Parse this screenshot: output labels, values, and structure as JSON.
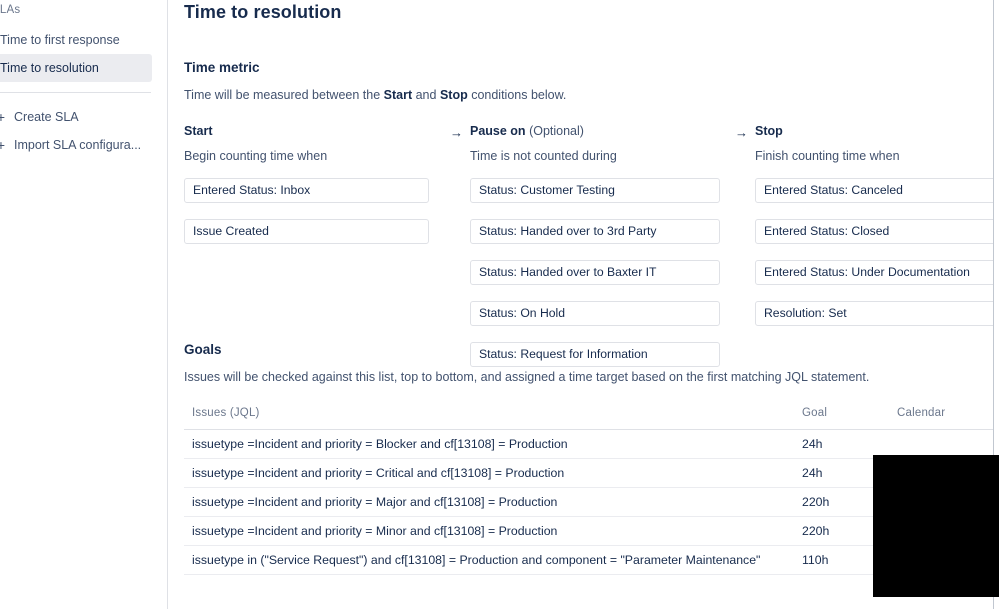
{
  "sidebar": {
    "heading": "SLAs",
    "items": [
      {
        "label": "Time to first response",
        "selected": false
      },
      {
        "label": "Time to resolution",
        "selected": true
      }
    ],
    "actions": [
      {
        "icon": "plus-icon",
        "label": "Create SLA"
      },
      {
        "icon": "plus-icon",
        "label": "Import SLA configura..."
      }
    ]
  },
  "main": {
    "page_title": "Time to resolution",
    "time_metric": {
      "title": "Time metric",
      "desc_prefix": "Time will be measured between the ",
      "desc_start": "Start",
      "desc_mid": " and ",
      "desc_stop": "Stop",
      "desc_suffix": " conditions below."
    },
    "arrow_glyph": "→",
    "columns": {
      "start": {
        "title": "Start",
        "optional": "",
        "subtitle": "Begin counting time when",
        "conditions": [
          "Entered Status: Inbox",
          "Issue Created"
        ]
      },
      "pause": {
        "title": "Pause on",
        "optional": "(Optional)",
        "subtitle": "Time is not counted during",
        "conditions": [
          "Status: Customer Testing",
          "Status: Handed over to 3rd Party",
          "Status: Handed over to Baxter IT",
          "Status: On Hold",
          "Status: Request for Information"
        ]
      },
      "stop": {
        "title": "Stop",
        "optional": "",
        "subtitle": "Finish counting time when",
        "conditions": [
          "Entered Status: Canceled",
          "Entered Status: Closed",
          "Entered Status: Under Documentation",
          "Resolution: Set"
        ]
      }
    },
    "goals": {
      "title": "Goals",
      "desc": "Issues will be checked against this list, top to bottom, and assigned a time target based on the first matching JQL statement.",
      "columns": [
        "Issues (JQL)",
        "Goal",
        "Calendar"
      ],
      "rows": [
        {
          "jql": "issuetype =Incident and priority = Blocker and cf[13108] = Production",
          "goal": "24h",
          "calendar": ""
        },
        {
          "jql": "issuetype =Incident and priority = Critical and cf[13108] = Production",
          "goal": "24h",
          "calendar": ""
        },
        {
          "jql": "issuetype =Incident and priority = Major and cf[13108] = Production",
          "goal": "220h",
          "calendar": ""
        },
        {
          "jql": "issuetype =Incident and priority = Minor and cf[13108] = Production",
          "goal": "220h",
          "calendar": ""
        },
        {
          "jql": "issuetype in (\"Service Request\") and cf[13108] = Production and component = \"Parameter Maintenance\"",
          "goal": "110h",
          "calendar": ""
        }
      ]
    }
  },
  "colors": {
    "text_primary": "#172b4d",
    "text_subtle": "#42526e",
    "text_muted": "#6b778c",
    "selected_bg": "#ebecf0",
    "border": "#dfe1e6",
    "redaction": "#000000"
  }
}
